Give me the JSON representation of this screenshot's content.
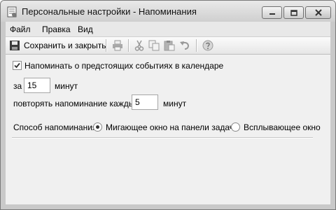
{
  "window": {
    "title": "Персональные настройки - Напоминания"
  },
  "menu": {
    "items": [
      "Файл",
      "Правка",
      "Вид"
    ]
  },
  "toolbar": {
    "save_close_label": "Сохранить и закрыть"
  },
  "reminders": {
    "enable_label": "Напоминать о предстоящих событиях в календаре",
    "enable_checked": true,
    "before_prefix": "за",
    "before_value": "15",
    "before_unit": "минут",
    "repeat_prefix": "повторять напоминание каждые",
    "repeat_value": "5",
    "repeat_unit": "минут",
    "method_label": "Способ напоминания:",
    "method_options": [
      "Мигающее окно на панели задач",
      "Всплывающее окно"
    ],
    "method_selected": "Мигающее окно на панели задач"
  },
  "icons": [
    "app-icon",
    "minimize-icon",
    "maximize-icon",
    "close-icon",
    "save-icon",
    "print-icon",
    "cut-icon",
    "copy-icon",
    "paste-icon",
    "undo-icon",
    "help-icon",
    "checkmark-icon"
  ]
}
